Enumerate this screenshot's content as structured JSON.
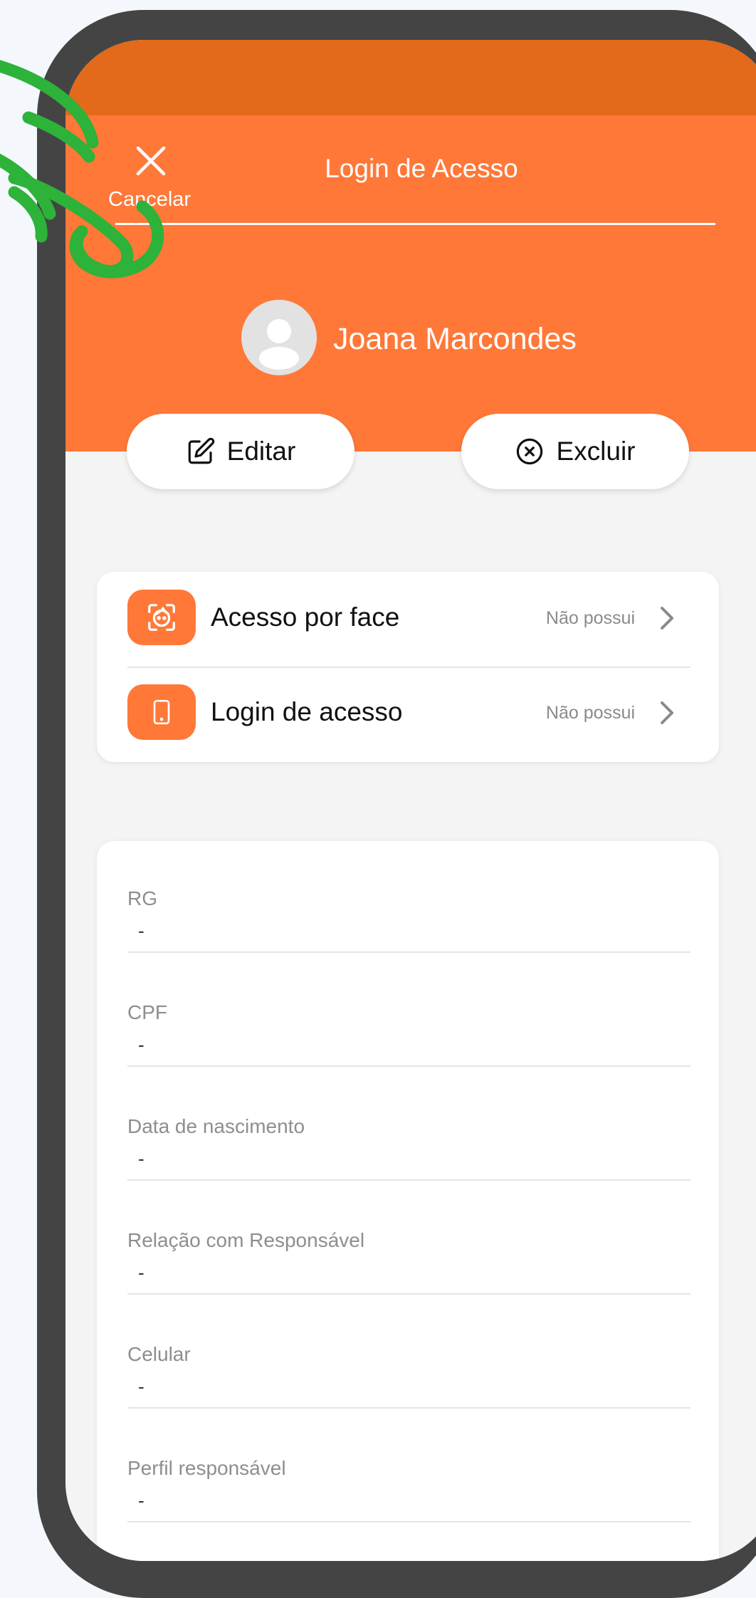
{
  "colors": {
    "accent": "#ff7838",
    "status_bar": "#e26a1a",
    "frame": "#444444",
    "gesture": "#2db23a"
  },
  "header": {
    "cancel_label": "Cancelar",
    "title": "Login de Acesso",
    "close_icon": "close-icon"
  },
  "profile": {
    "name": "Joana Marcondes",
    "avatar_icon": "user-avatar-icon"
  },
  "actions": {
    "edit_label": "Editar",
    "edit_icon": "edit-icon",
    "delete_label": "Excluir",
    "delete_icon": "x-circle-icon"
  },
  "access_items": [
    {
      "label": "Acesso por face",
      "status": "Não possui",
      "icon": "face-scan-icon"
    },
    {
      "label": "Login de acesso",
      "status": "Não possui",
      "icon": "phone-icon"
    }
  ],
  "info_fields": [
    {
      "label": "RG",
      "value": "-"
    },
    {
      "label": "CPF",
      "value": "-"
    },
    {
      "label": "Data de nascimento",
      "value": "-"
    },
    {
      "label": "Relação com Responsável",
      "value": "-"
    },
    {
      "label": "Celular",
      "value": "-"
    },
    {
      "label": "Perfil responsável",
      "value": "-"
    }
  ]
}
